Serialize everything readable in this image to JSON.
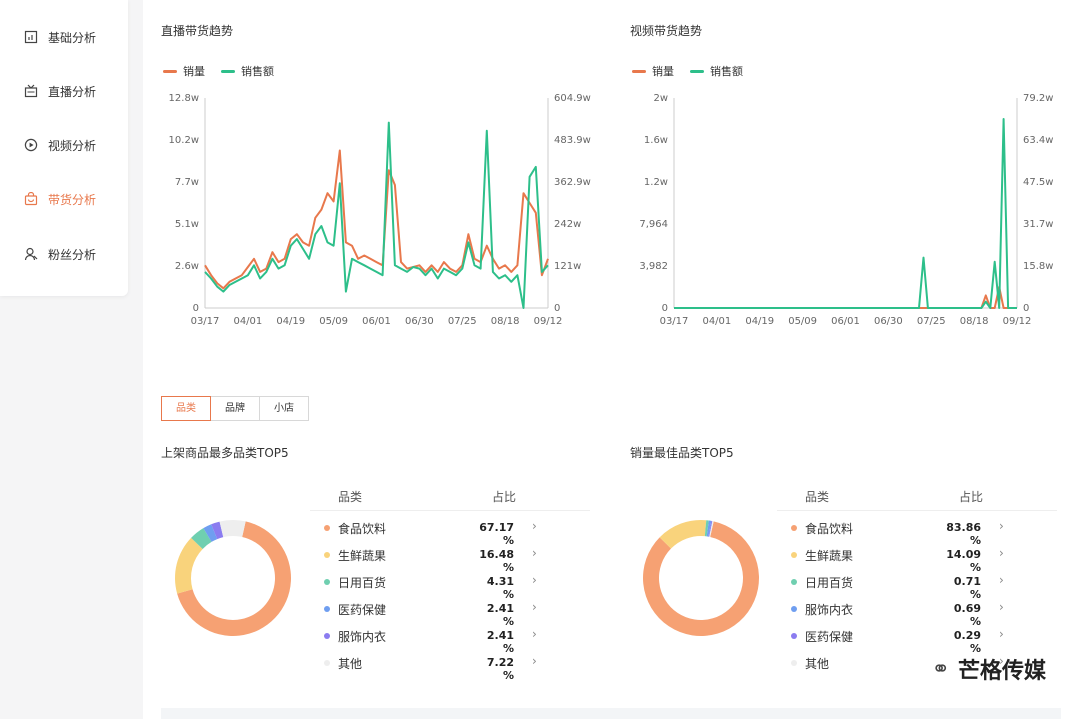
{
  "sidebar": {
    "items": [
      {
        "label": "基础分析",
        "icon": "chart-icon",
        "active": false
      },
      {
        "label": "直播分析",
        "icon": "live-icon",
        "active": false
      },
      {
        "label": "视频分析",
        "icon": "play-icon",
        "active": false
      },
      {
        "label": "带货分析",
        "icon": "bag-icon",
        "active": true
      },
      {
        "label": "粉丝分析",
        "icon": "user-icon",
        "active": false
      }
    ]
  },
  "live_section": {
    "title": "直播带货趋势"
  },
  "video_section": {
    "title": "视频带货趋势"
  },
  "legend": {
    "sales_qty": "销量",
    "sales_amount": "销售额"
  },
  "colors": {
    "sales_qty": "#e8784c",
    "sales_amount": "#2dbf8a",
    "accent": "#e8784c"
  },
  "chart_data": [
    {
      "type": "line",
      "title": "直播带货趋势",
      "x_ticks": [
        "03/17",
        "04/01",
        "04/19",
        "05/09",
        "06/01",
        "06/30",
        "07/25",
        "08/18",
        "09/12"
      ],
      "y_left_ticks": [
        "0",
        "2.6w",
        "5.1w",
        "7.7w",
        "10.2w",
        "12.8w"
      ],
      "y_right_ticks": [
        "0",
        "121w",
        "242w",
        "362.9w",
        "483.9w",
        "604.9w"
      ],
      "ylim_left": [
        0,
        128000
      ],
      "series": [
        {
          "name": "销量",
          "values": [
            26000,
            20000,
            15000,
            12000,
            16000,
            18000,
            20000,
            25000,
            30000,
            22000,
            24000,
            34000,
            28000,
            30000,
            42000,
            45000,
            40000,
            38000,
            55000,
            60000,
            70000,
            65000,
            96000,
            40000,
            38000,
            30000,
            32000,
            30000,
            28000,
            26000,
            84000,
            75000,
            28000,
            24000,
            25000,
            26000,
            22000,
            26000,
            22000,
            28000,
            24000,
            22000,
            26000,
            45000,
            30000,
            28000,
            38000,
            30000,
            24000,
            26000,
            22000,
            26000,
            70000,
            64000,
            58000,
            20000,
            30000
          ]
        },
        {
          "name": "销售额",
          "values": [
            22000,
            18000,
            13000,
            10000,
            14000,
            16000,
            18000,
            20000,
            26000,
            18000,
            22000,
            30000,
            24000,
            26000,
            38000,
            42000,
            36000,
            30000,
            45000,
            50000,
            40000,
            38000,
            76000,
            10000,
            30000,
            28000,
            26000,
            24000,
            22000,
            20000,
            113000,
            26000,
            24000,
            22000,
            25000,
            24000,
            20000,
            24000,
            18000,
            24000,
            22000,
            20000,
            24000,
            40000,
            26000,
            24000,
            108000,
            22000,
            18000,
            20000,
            16000,
            20000,
            0,
            80000,
            86000,
            22000,
            26000
          ]
        }
      ]
    },
    {
      "type": "line",
      "title": "视频带货趋势",
      "x_ticks": [
        "03/17",
        "04/01",
        "04/19",
        "05/09",
        "06/01",
        "06/30",
        "07/25",
        "08/18",
        "09/12"
      ],
      "y_left_ticks": [
        "0",
        "3,982",
        "7,964",
        "1.2w",
        "1.6w",
        "2w"
      ],
      "y_right_ticks": [
        "0",
        "15.8w",
        "31.7w",
        "47.5w",
        "63.4w",
        "79.2w"
      ],
      "ylim_left": [
        0,
        20000
      ],
      "series": [
        {
          "name": "销量",
          "values": [
            0,
            0,
            0,
            0,
            0,
            0,
            0,
            0,
            0,
            0,
            0,
            0,
            0,
            0,
            0,
            0,
            0,
            0,
            0,
            0,
            0,
            0,
            0,
            0,
            0,
            0,
            0,
            0,
            0,
            0,
            0,
            0,
            0,
            0,
            0,
            0,
            0,
            0,
            0,
            0,
            0,
            0,
            0,
            0,
            0,
            0,
            0,
            0,
            0,
            0,
            0,
            0,
            0,
            0,
            0,
            0,
            0,
            0,
            0,
            0,
            0,
            0,
            0,
            0,
            0,
            0,
            0,
            0,
            0,
            0,
            1200,
            0,
            0,
            2000,
            0,
            0,
            0,
            0
          ]
        },
        {
          "name": "销售额",
          "values": [
            0,
            0,
            0,
            0,
            0,
            0,
            0,
            0,
            0,
            0,
            0,
            0,
            0,
            0,
            0,
            0,
            0,
            0,
            0,
            0,
            0,
            0,
            0,
            0,
            0,
            0,
            0,
            0,
            0,
            0,
            0,
            0,
            0,
            0,
            0,
            0,
            0,
            0,
            0,
            0,
            0,
            0,
            0,
            0,
            0,
            0,
            0,
            0,
            0,
            0,
            0,
            0,
            0,
            0,
            0,
            0,
            4800,
            0,
            0,
            0,
            0,
            0,
            0,
            0,
            0,
            0,
            0,
            0,
            0,
            0,
            600,
            0,
            4400,
            0,
            18000,
            0,
            0,
            0
          ]
        }
      ]
    },
    {
      "type": "pie",
      "title": "上架商品最多品类TOP5",
      "categories": [
        "食品饮料",
        "生鲜蔬果",
        "日用百货",
        "医药保健",
        "服饰内衣",
        "其他"
      ],
      "values": [
        67.17,
        16.48,
        4.31,
        2.41,
        2.41,
        7.22
      ]
    },
    {
      "type": "pie",
      "title": "销量最佳品类TOP5",
      "categories": [
        "食品饮料",
        "生鲜蔬果",
        "日用百货",
        "服饰内衣",
        "医药保健",
        "其他"
      ],
      "values": [
        83.86,
        14.09,
        0.71,
        0.69,
        0.29,
        0.36
      ]
    }
  ],
  "tabs": [
    "品类",
    "品牌",
    "小店"
  ],
  "table_headers": {
    "category": "品类",
    "share": "占比"
  },
  "top_listed": {
    "title": "上架商品最多品类TOP5",
    "rows": [
      {
        "name": "食品饮料",
        "pct": "67.17 %",
        "color": "#f6a173"
      },
      {
        "name": "生鲜蔬果",
        "pct": "16.48 %",
        "color": "#f9d37c"
      },
      {
        "name": "日用百货",
        "pct": "4.31 %",
        "color": "#6fcfb0"
      },
      {
        "name": "医药保健",
        "pct": "2.41 %",
        "color": "#6f9ef0"
      },
      {
        "name": "服饰内衣",
        "pct": "2.41 %",
        "color": "#8b7cf0"
      },
      {
        "name": "其他",
        "pct": "7.22 %",
        "color": "#eeeeee"
      }
    ]
  },
  "top_sales": {
    "title": "销量最佳品类TOP5",
    "rows": [
      {
        "name": "食品饮料",
        "pct": "83.86 %",
        "color": "#f6a173"
      },
      {
        "name": "生鲜蔬果",
        "pct": "14.09 %",
        "color": "#f9d37c"
      },
      {
        "name": "日用百货",
        "pct": "0.71 %",
        "color": "#6fcfb0"
      },
      {
        "name": "服饰内衣",
        "pct": "0.69 %",
        "color": "#6f9ef0"
      },
      {
        "name": "医药保健",
        "pct": "0.29 %",
        "color": "#8b7cf0"
      },
      {
        "name": "其他",
        "pct": "",
        "color": "#eeeeee"
      }
    ]
  },
  "footer_watermark": "芒格传媒"
}
